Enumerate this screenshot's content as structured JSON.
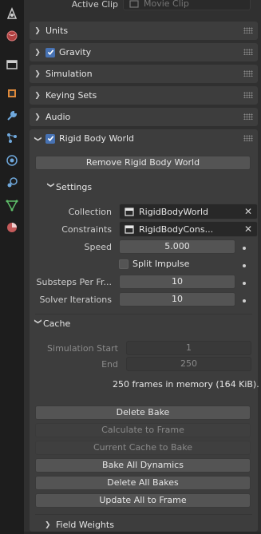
{
  "header": {
    "active_clip_label": "Active Clip",
    "active_clip_value": "Movie Clip"
  },
  "sections": {
    "units": "Units",
    "gravity": "Gravity",
    "simulation": "Simulation",
    "keying_sets": "Keying Sets",
    "audio": "Audio",
    "rigid_body_world": "Rigid Body World"
  },
  "rigid_body": {
    "remove_button": "Remove Rigid Body World",
    "settings_title": "Settings",
    "collection_label": "Collection",
    "collection_value": "RigidBodyWorld",
    "constraints_label": "Constraints",
    "constraints_value": "RigidBodyCons...",
    "speed_label": "Speed",
    "speed_value": "5.000",
    "split_impulse_label": "Split Impulse",
    "substeps_label": "Substeps Per Fr...",
    "substeps_value": "10",
    "solver_label": "Solver Iterations",
    "solver_value": "10"
  },
  "cache": {
    "title": "Cache",
    "sim_start_label": "Simulation Start",
    "sim_start_value": "1",
    "end_label": "End",
    "end_value": "250",
    "info": "250 frames in memory (164 KiB).",
    "buttons": {
      "delete_bake": "Delete Bake",
      "calculate_to_frame": "Calculate to Frame",
      "current_cache_to_bake": "Current Cache to Bake",
      "bake_all_dynamics": "Bake All Dynamics",
      "delete_all_bakes": "Delete All Bakes",
      "update_all_to_frame": "Update All to Frame"
    }
  },
  "field_weights": "Field Weights",
  "icons": [
    "tool-icon",
    "render-icon",
    "output-icon",
    "view-layer-icon",
    "scene-icon",
    "world-icon",
    "object-icon",
    "modifier-icon",
    "particles-icon",
    "physics-icon",
    "constraints-icon",
    "data-icon",
    "material-icon"
  ],
  "colors": {
    "accent": "#4772b3",
    "panel": "#3d3d3d",
    "background": "#303030"
  }
}
